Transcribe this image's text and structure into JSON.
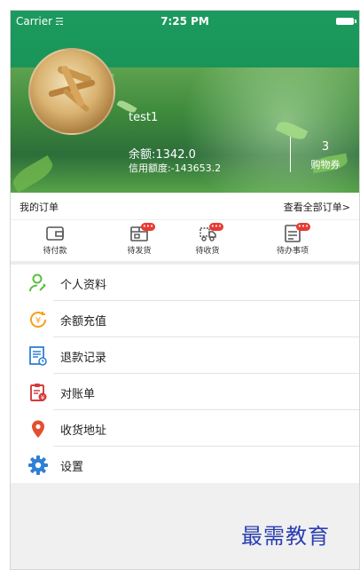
{
  "status_bar": {
    "carrier": "Carrier",
    "wifi_icon": "wifi-icon",
    "time": "7:25 PM",
    "battery_icon": "battery-icon"
  },
  "profile": {
    "username": "test1",
    "balance": "余额:1342.0",
    "credit": "信用额度:-143653.2",
    "coupon_count": "3",
    "coupon_label": "购物券"
  },
  "orders": {
    "title": "我的订单",
    "view_all": "查看全部订单>",
    "items": [
      {
        "label": "待付款",
        "icon": "wallet-icon",
        "badge": ""
      },
      {
        "label": "待发货",
        "icon": "package-icon",
        "badge": "•••"
      },
      {
        "label": "待收货",
        "icon": "truck-icon",
        "badge": "•••"
      },
      {
        "label": "待办事项",
        "icon": "todo-list-icon",
        "badge": "•••"
      }
    ]
  },
  "menu": [
    {
      "label": "个人资料",
      "icon": "user-profile-icon",
      "color": "#57c13a"
    },
    {
      "label": "余额充值",
      "icon": "yen-recharge-icon",
      "color": "#f3a21b"
    },
    {
      "label": "退款记录",
      "icon": "refund-record-icon",
      "color": "#2f7fd6"
    },
    {
      "label": "对账单",
      "icon": "statement-icon",
      "color": "#d63a3a"
    },
    {
      "label": "收货地址",
      "icon": "location-pin-icon",
      "color": "#e3502e"
    },
    {
      "label": "设置",
      "icon": "settings-gear-icon",
      "color": "#2f7fd6"
    }
  ],
  "watermark": "最需教育",
  "colors": {
    "header_green": "#1a9559",
    "badge_red": "#e73b33"
  }
}
